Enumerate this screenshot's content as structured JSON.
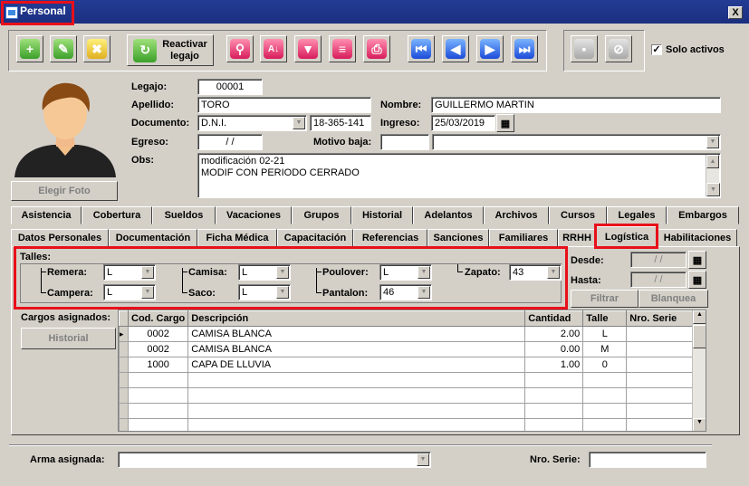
{
  "window": {
    "title": "Personal",
    "close": "X"
  },
  "toolbar": {
    "reactivar_label_1": "Reactivar",
    "reactivar_label_2": "legajo",
    "solo_activos_label": "Solo activos",
    "solo_activos_checked": true
  },
  "photo": {
    "button_label": "Elegir Foto"
  },
  "form": {
    "legajo_label": "Legajo:",
    "legajo_value": "00001",
    "apellido_label": "Apellido:",
    "apellido_value": "TORO",
    "nombre_label": "Nombre:",
    "nombre_value": "GUILLERMO MARTIN",
    "documento_label": "Documento:",
    "documento_type": "D.N.I.",
    "documento_value": "18-365-141",
    "ingreso_label": "Ingreso:",
    "ingreso_value": "25/03/2019",
    "egreso_label": "Egreso:",
    "egreso_value": "/ /",
    "motivo_label": "Motivo baja:",
    "motivo_value": "",
    "motivo_select": "",
    "obs_label": "Obs:",
    "obs_line1": "modificación 02-21",
    "obs_line2": "MODIF CON PERIODO CERRADO"
  },
  "tabs_row1": [
    "Asistencia",
    "Cobertura",
    "Sueldos",
    "Vacaciones",
    "Grupos",
    "Historial",
    "Adelantos",
    "Archivos",
    "Cursos",
    "Legales",
    "Embargos"
  ],
  "tabs_row2": [
    "Datos Personales",
    "Documentación",
    "Ficha Médica",
    "Capacitación",
    "Referencias",
    "Sanciones",
    "Familiares",
    "RRHH",
    "Logística",
    "Habilitaciones"
  ],
  "talles": {
    "title": "Talles:",
    "remera_label": "Remera:",
    "remera": "L",
    "campera_label": "Campera:",
    "campera": "L",
    "camisa_label": "Camisa:",
    "camisa": "L",
    "saco_label": "Saco:",
    "saco": "L",
    "poulover_label": "Poulover:",
    "poulover": "L",
    "pantalon_label": "Pantalon:",
    "pantalon": "46",
    "zapato_label": "Zapato:",
    "zapato": "43"
  },
  "filter": {
    "desde_label": "Desde:",
    "desde": "/ /",
    "hasta_label": "Hasta:",
    "hasta": "/ /",
    "filtrar": "Filtrar",
    "blanquea": "Blanquea"
  },
  "cargos": {
    "label": "Cargos asignados:",
    "historial_button": "Historial",
    "columns": [
      "Cod. Cargo",
      "Descripción",
      "Cantidad",
      "Talle",
      "Nro. Serie"
    ],
    "rows": [
      [
        "0002",
        "CAMISA BLANCA",
        "2.00",
        "L",
        ""
      ],
      [
        "0002",
        "CAMISA BLANCA",
        "0.00",
        "M",
        ""
      ],
      [
        "1000",
        "CAPA DE LLUVIA",
        "1.00",
        "0",
        ""
      ]
    ]
  },
  "arma": {
    "label": "Arma asignada:",
    "value": "",
    "serie_label": "Nro. Serie:",
    "serie_value": ""
  }
}
